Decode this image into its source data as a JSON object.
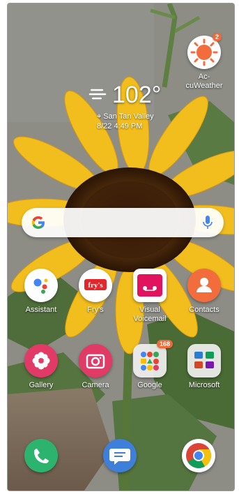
{
  "weather_widget": {
    "temperature": "102°",
    "location": "San Tan Valley",
    "updated": "8/22 4:49 PM"
  },
  "weather_app": {
    "label_line1": "Ac-",
    "label_line2": "cuWeather",
    "badge": "2"
  },
  "search_bar": {
    "icon": "google-g-icon",
    "mic_icon": "microphone-icon"
  },
  "apps_row1": [
    {
      "label": "Assistant",
      "icon": "google-assistant-icon"
    },
    {
      "label": "Fry's",
      "icon": "frys-icon"
    },
    {
      "label_line1": "Visual",
      "label_line2": "Voicemail",
      "icon": "visual-voicemail-icon"
    },
    {
      "label": "Contacts",
      "icon": "contacts-icon"
    }
  ],
  "apps_row2": [
    {
      "label": "Gallery",
      "icon": "gallery-icon"
    },
    {
      "label": "Camera",
      "icon": "camera-icon"
    },
    {
      "label": "Google",
      "icon": "google-folder-icon",
      "badge": "168"
    },
    {
      "label": "Microsoft",
      "icon": "microsoft-folder-icon"
    }
  ],
  "dock": [
    {
      "icon": "phone-icon"
    },
    {
      "icon": "messages-icon"
    },
    {
      "icon": "chrome-icon"
    }
  ],
  "colors": {
    "orange": "#f26c3c",
    "pink": "#e13a66",
    "sunflower": "#f2be1e",
    "sky_overlay": "#8c8c84"
  }
}
